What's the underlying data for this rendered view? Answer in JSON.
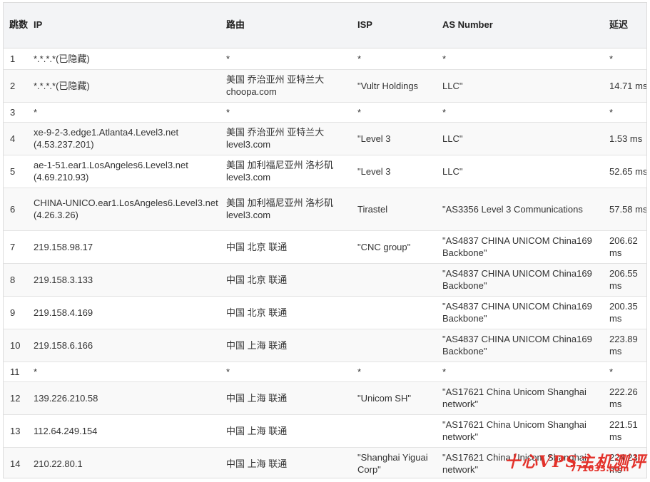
{
  "headers": {
    "hop": "跳数",
    "ip": "IP",
    "route": "路由",
    "isp": "ISP",
    "as": "AS Number",
    "latency": "延迟"
  },
  "rows": [
    {
      "hop": "1",
      "ip": "*.*.*.*(已隐藏)",
      "route": "*",
      "isp": "*",
      "as": "*",
      "latency": "*"
    },
    {
      "hop": "2",
      "ip": "*.*.*.*(已隐藏)",
      "route": "美国 乔治亚州 亚特兰大 choopa.com",
      "isp": "\"Vultr Holdings",
      "as": "LLC\"",
      "latency": "14.71 ms"
    },
    {
      "hop": "3",
      "ip": "*",
      "route": "*",
      "isp": "*",
      "as": "*",
      "latency": "*"
    },
    {
      "hop": "4",
      "ip": "xe-9-2-3.edge1.Atlanta4.Level3.net (4.53.237.201)",
      "route": "美国 乔治亚州 亚特兰大 level3.com",
      "isp": "\"Level 3",
      "as": "LLC\"",
      "latency": "1.53 ms"
    },
    {
      "hop": "5",
      "ip": "ae-1-51.ear1.LosAngeles6.Level3.net (4.69.210.93)",
      "route": "美国 加利福尼亚州 洛杉矶 level3.com",
      "isp": "\"Level 3",
      "as": "LLC\"",
      "latency": "52.65 ms"
    },
    {
      "hop": "6",
      "ip": "CHINA-UNICO.ear1.LosAngeles6.Level3.net (4.26.3.26)",
      "route": "美国 加利福尼亚州 洛杉矶 level3.com",
      "isp": "Tirastel",
      "as": "\"AS3356 Level 3 Communications",
      "latency": "57.58 ms"
    },
    {
      "hop": "7",
      "ip": "219.158.98.17",
      "route": "中国 北京 联通",
      "isp": "\"CNC group\"",
      "as": "\"AS4837 CHINA UNICOM China169 Backbone\"",
      "latency": "206.62 ms"
    },
    {
      "hop": "8",
      "ip": "219.158.3.133",
      "route": "中国 北京 联通",
      "isp": "",
      "as": "\"AS4837 CHINA UNICOM China169 Backbone\"",
      "latency": "206.55 ms"
    },
    {
      "hop": "9",
      "ip": "219.158.4.169",
      "route": "中国 北京 联通",
      "isp": "",
      "as": "\"AS4837 CHINA UNICOM China169 Backbone\"",
      "latency": "200.35 ms"
    },
    {
      "hop": "10",
      "ip": "219.158.6.166",
      "route": "中国 上海 联通",
      "isp": "",
      "as": "\"AS4837 CHINA UNICOM China169 Backbone\"",
      "latency": "223.89 ms"
    },
    {
      "hop": "11",
      "ip": "*",
      "route": "*",
      "isp": "*",
      "as": "*",
      "latency": "*"
    },
    {
      "hop": "12",
      "ip": "139.226.210.58",
      "route": "中国 上海 联通",
      "isp": "\"Unicom SH\"",
      "as": "\"AS17621 China Unicom Shanghai network\"",
      "latency": "222.26 ms"
    },
    {
      "hop": "13",
      "ip": "112.64.249.154",
      "route": "中国 上海 联通",
      "isp": "",
      "as": "\"AS17621 China Unicom Shanghai network\"",
      "latency": "221.51 ms"
    },
    {
      "hop": "14",
      "ip": "210.22.80.1",
      "route": "中国 上海 联通",
      "isp": "\"Shanghai Yiguai Corp\"",
      "as": "\"AS17621 China Unicom Shanghai network\"",
      "latency": "224.23 ms"
    }
  ],
  "watermark": {
    "title": "十心VPS主机测评",
    "url": "771633.com"
  }
}
